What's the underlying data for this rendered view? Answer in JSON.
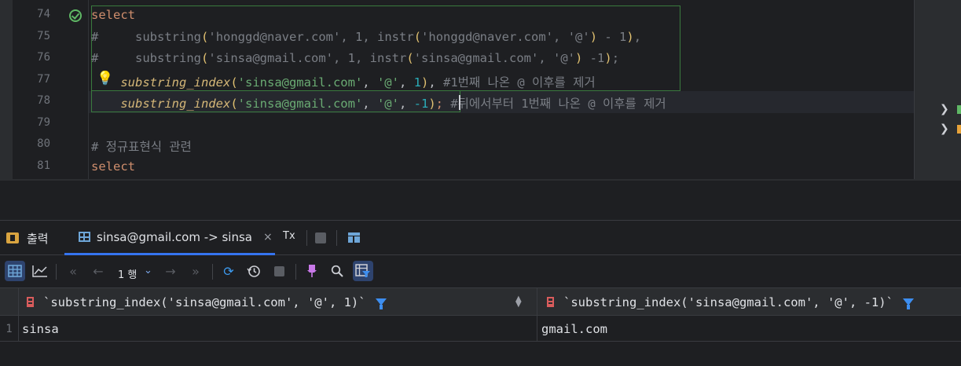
{
  "editor": {
    "line_numbers": [
      "74",
      "75",
      "76",
      "77",
      "78",
      "79",
      "80",
      "81"
    ],
    "line74": {
      "keyword": "select"
    },
    "line75": {
      "hash": "#",
      "func": "substring",
      "p1": "(",
      "str1": "'honggd@naver.com'",
      "args1": ", 1, ",
      "func2": "instr",
      "p2": "(",
      "str2": "'honggd@naver.com'",
      "sep": ", ",
      "str3": "'@'",
      "p3": ")",
      "rest": " - 1",
      "p4": ")",
      "tail": ","
    },
    "line76": {
      "hash": "#",
      "func": "substring",
      "p1": "(",
      "str1": "'sinsa@gmail.com'",
      "args1": ", 1, ",
      "func2": "instr",
      "p2": "(",
      "str2": "'sinsa@gmail.com'",
      "sep": ", ",
      "str3": "'@'",
      "p3": ")",
      "rest": " -1",
      "p4": ")",
      "tail": ";"
    },
    "line77": {
      "func": "substring_index",
      "p1": "(",
      "str1": "'sinsa@gmail.com'",
      "c1": ", ",
      "str2": "'@'",
      "c2": ", ",
      "num": "1",
      "p2": ")",
      "c3": ", ",
      "comment": "#1번째 나온 @ 이후를 제거"
    },
    "line78": {
      "func": "substring_index",
      "p1": "(",
      "str1": "'sinsa@gmail.com'",
      "c1": ", ",
      "str2": "'@'",
      "c2": ", ",
      "num": "-1",
      "p2": ")",
      "semi": ";",
      "comment": "#뒤에서부터 1번째 나온 @ 이후를 제거"
    },
    "line80": {
      "comment": "# 정규표현식 관련"
    },
    "line81": {
      "keyword": "select"
    }
  },
  "tool_window": {
    "tabs": {
      "output_label": "출력",
      "result_label": "sinsa@gmail.com -> sinsa",
      "close_glyph": "×",
      "tx_label": "Tx"
    },
    "toolbar": {
      "row_count": "1 행",
      "icons": [
        "table-view-icon",
        "chart-view-icon",
        "first-page-icon",
        "prev-page-icon",
        "next-page-icon",
        "last-page-icon",
        "refresh-icon",
        "history-icon",
        "stop-icon",
        "pin-icon",
        "search-icon",
        "filter-settings-icon"
      ]
    },
    "table": {
      "columns": [
        "`substring_index('sinsa@gmail.com', '@', 1)`",
        "`substring_index('sinsa@gmail.com', '@', -1)`"
      ],
      "rows": [
        {
          "num": "1",
          "cells": [
            "sinsa",
            "gmail.com"
          ]
        }
      ]
    }
  },
  "colors": {
    "background": "#1e1f22",
    "keyword": "#cf8e6d",
    "string": "#6aab73",
    "number": "#2aacb8",
    "function_italic": "#d5b778",
    "comment": "#7a7e85",
    "accent": "#3574f0"
  }
}
